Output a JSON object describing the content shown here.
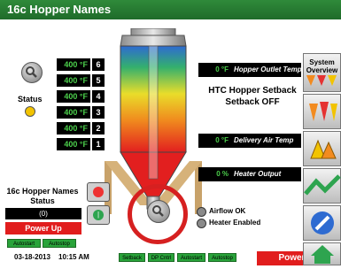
{
  "window": {
    "title": "16c Hopper Names"
  },
  "zones": [
    {
      "value": "400 °F",
      "number": "6"
    },
    {
      "value": "400 °F",
      "number": "5"
    },
    {
      "value": "400 °F",
      "number": "4"
    },
    {
      "value": "400 °F",
      "number": "3"
    },
    {
      "value": "400 °F",
      "number": "2"
    },
    {
      "value": "400 °F",
      "number": "1"
    }
  ],
  "status_label": "Status",
  "outlet": {
    "value": "0 °F",
    "label": "Hopper Outlet Temp"
  },
  "setback": {
    "line1": "HTC Hopper Setback",
    "line2": "Setback OFF"
  },
  "delivery": {
    "value": "0 °F",
    "label": "Delivery Air Temp"
  },
  "heater": {
    "value": "0 %",
    "label": "Heater Output"
  },
  "indicators": {
    "airflow": "Airflow OK",
    "heater_enabled": "Heater Enabled"
  },
  "hopper_panel": {
    "title_line1": "16c Hopper Names",
    "title_line2": "Status",
    "value": "(0)",
    "power_up": "Power Up",
    "autostart": "Autostart",
    "autostop": "Autostop"
  },
  "footer": {
    "date": "03-18-2013",
    "time": "10:15 AM",
    "buttons": [
      "Setback",
      "DP Cntrl",
      "Autostart",
      "Autostop"
    ],
    "power_up": "Power Up"
  },
  "sidebar": {
    "system_overview_line1": "System",
    "system_overview_line2": "Overview"
  },
  "colors": {
    "title_green": "#2f8a3a",
    "display_green": "#4cd04c",
    "alert_red": "#e11d1d",
    "status_amber": "#f2c300"
  }
}
